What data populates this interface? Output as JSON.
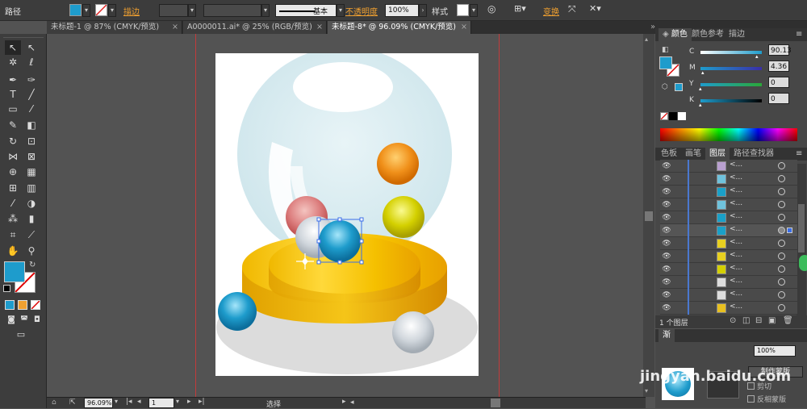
{
  "control_bar": {
    "path_label": "路径",
    "stroke_label": "描边",
    "stroke_style_label": "基本",
    "opacity_label": "不透明度",
    "opacity_value": "100%",
    "style_label": "样式",
    "transform_label": "变换",
    "colors": {
      "fill": "#1e9ccc",
      "stroke": "#ffffff"
    }
  },
  "tabs": [
    {
      "label": "未标题-1 @ 87% (CMYK/预览)",
      "close": "×"
    },
    {
      "label": "A0000011.ai* @ 25% (RGB/预览)",
      "close": "×"
    },
    {
      "label": "未标题-8* @ 96.09% (CMYK/预览)",
      "close": "×"
    }
  ],
  "color_panel": {
    "tabs": [
      "颜色",
      "颜色参考",
      "描边"
    ],
    "sliders": [
      {
        "label": "C",
        "value": "90.13",
        "color": "#1e9ccc"
      },
      {
        "label": "M",
        "value": "4.36",
        "color": "#8a2a9a"
      },
      {
        "label": "Y",
        "value": "0",
        "color": "#1a9a4a"
      },
      {
        "label": "K",
        "value": "0",
        "color": "#111111"
      }
    ]
  },
  "layers_panel": {
    "tabs": [
      "色板",
      "画笔",
      "图层",
      "路径查找器"
    ],
    "rows": [
      {
        "name": "<...",
        "thumb": "#b9a0d0",
        "selected": false
      },
      {
        "name": "<...",
        "thumb": "#6fc2dc",
        "selected": false
      },
      {
        "name": "<...",
        "thumb": "#1aa0c8",
        "selected": false
      },
      {
        "name": "<...",
        "thumb": "#6fc2dc",
        "selected": false
      },
      {
        "name": "<...",
        "thumb": "#1aa0c8",
        "selected": false
      },
      {
        "name": "<...",
        "thumb": "#1aa0c8",
        "selected": true
      },
      {
        "name": "<...",
        "thumb": "#e8d020",
        "selected": false
      },
      {
        "name": "<...",
        "thumb": "#e8d020",
        "selected": false
      },
      {
        "name": "<...",
        "thumb": "#d4d000",
        "selected": false
      },
      {
        "name": "<...",
        "thumb": "#dddddd",
        "selected": false
      },
      {
        "name": "<...",
        "thumb": "#dddddd",
        "selected": false
      },
      {
        "name": "<...",
        "thumb": "#e8c020",
        "selected": false
      }
    ],
    "layer_count": "1 个图层"
  },
  "transparency_panel": {
    "tab": "渐",
    "opacity_value": "100%",
    "make_mask_label": "制作蒙版",
    "clip_label": "剪切",
    "invert_label": "反相蒙版"
  },
  "watermark": {
    "text": "jingyan.baidu.com"
  },
  "status_bar": {
    "zoom": "96.09%",
    "page": "1",
    "tool_label": "选择"
  }
}
